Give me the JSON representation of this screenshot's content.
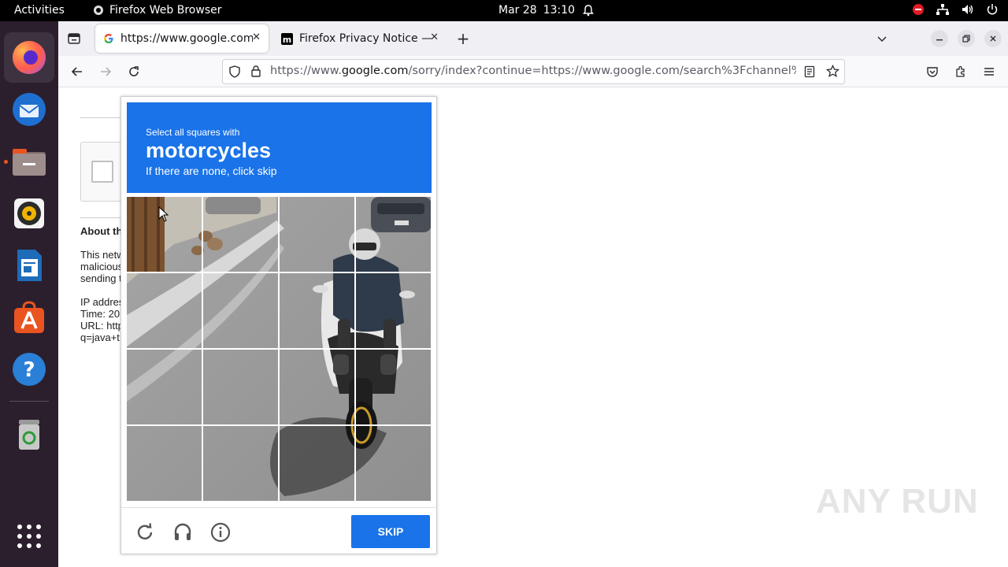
{
  "system_bar": {
    "activities": "Activities",
    "app_name": "Firefox Web Browser",
    "date": "Mar 28",
    "time": "13:10"
  },
  "dock": {
    "items": [
      "firefox-icon",
      "thunderbird-icon",
      "files-icon",
      "rhythmbox-icon",
      "writer-icon",
      "app-center-icon",
      "help-icon",
      "trash-icon",
      "show-apps-icon"
    ]
  },
  "tabs": [
    {
      "title": "https://www.google.com/",
      "favicon": "google-favicon"
    },
    {
      "title": "Firefox Privacy Notice —",
      "favicon": "mozilla-favicon"
    }
  ],
  "navbar": {
    "url_prefix": "https://www.",
    "url_domain": "google.com",
    "url_rest": "/sorry/index?continue=https://www.google.com/search%3Fchannel%3"
  },
  "page": {
    "about_heading": "About th",
    "para1_line1": "This netw",
    "para1_line2": "malicious",
    "para1_line3": "sending t",
    "ip_line": "IP addres",
    "time_line": "Time: 20",
    "url_line": "URL: http",
    "q_line": "q=java+t"
  },
  "captcha": {
    "instruction_small": "Select all squares with",
    "target": "motorcycles",
    "hint": "If there are none, click skip",
    "skip_label": "SKIP",
    "colors": {
      "header": "#1a73e8",
      "skip": "#1a73e8"
    }
  },
  "watermark": "ANY RUN"
}
